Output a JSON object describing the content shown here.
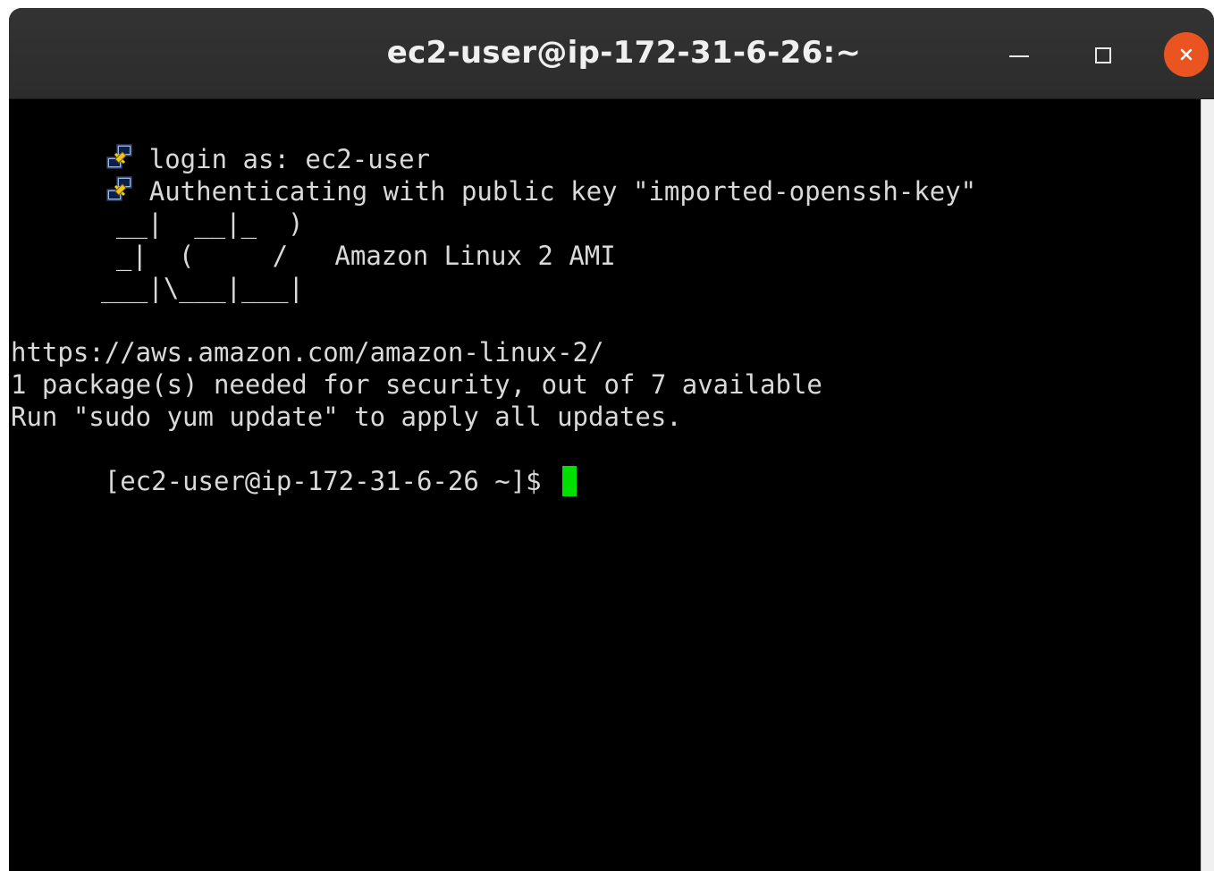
{
  "window": {
    "title": "ec2-user@ip-172-31-6-26:~",
    "minimize_icon": "minimize-icon",
    "maximize_icon": "maximize-icon",
    "close_icon": "close-icon",
    "close_color": "#e95420"
  },
  "terminal": {
    "login_line": "login as: ec2-user",
    "auth_line": "Authenticating with public key \"imported-openssh-key\"",
    "ascii_art": [
      "__|  __|_  )",
      "_|  (     /   Amazon Linux 2 AMI",
      "___|\\___|___|"
    ],
    "url_line": "https://aws.amazon.com/amazon-linux-2/",
    "security_line": "1 package(s) needed for security, out of 7 available",
    "update_line": "Run \"sudo yum update\" to apply all updates.",
    "prompt": "[ec2-user@ip-172-31-6-26 ~]$ ",
    "cursor_color": "#00e000",
    "session_icon": "putty-session-icon"
  }
}
